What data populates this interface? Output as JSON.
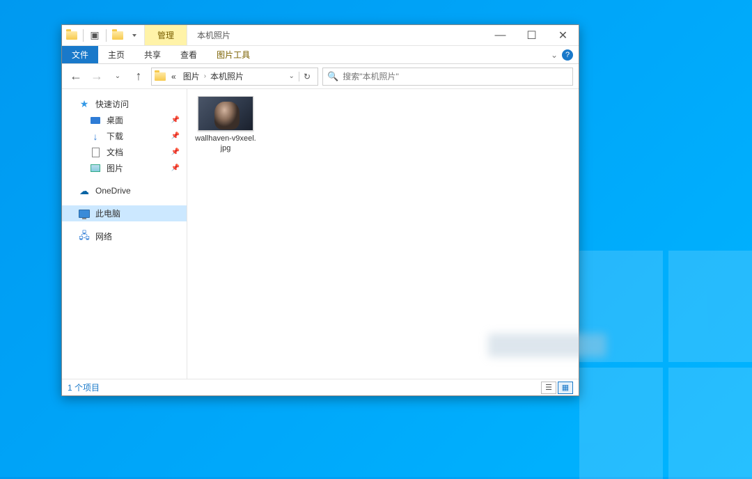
{
  "window": {
    "contextual_tab": "管理",
    "title": "本机照片"
  },
  "ribbon": {
    "file": "文件",
    "home": "主页",
    "share": "共享",
    "view": "查看",
    "picture_tools": "图片工具"
  },
  "nav": {
    "crumb_prefix": "«",
    "crumb1": "图片",
    "crumb2": "本机照片",
    "search_placeholder": "搜索\"本机照片\""
  },
  "sidebar": {
    "quick_access": "快速访问",
    "items": [
      {
        "label": "桌面"
      },
      {
        "label": "下载"
      },
      {
        "label": "文档"
      },
      {
        "label": "图片"
      }
    ],
    "onedrive": "OneDrive",
    "this_pc": "此电脑",
    "network": "网络"
  },
  "content": {
    "files": [
      {
        "name": "wallhaven-v9xeel.jpg"
      }
    ]
  },
  "status": {
    "count": "1 个项目"
  },
  "icons": {
    "back": "←",
    "forward": "→",
    "up": "↑",
    "refresh": "↻",
    "search": "🔍",
    "star": "★",
    "download": "↓",
    "cloud": "☁",
    "network": "🖧",
    "help": "?",
    "min": "—",
    "max": "☐",
    "close": "✕",
    "details": "☰",
    "thumbs": "▦",
    "pin": "📌"
  }
}
